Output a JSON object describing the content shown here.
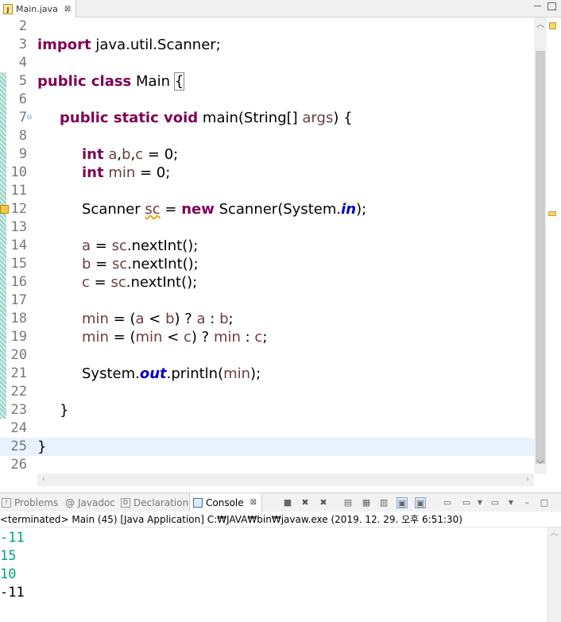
{
  "editor_tab": {
    "title": "Main.java",
    "close": "⊠",
    "icon": "J"
  },
  "window_buttons": {
    "minimize": "",
    "maximize": ""
  },
  "code_lines": [
    {
      "num": "2"
    },
    {
      "num": "3"
    },
    {
      "num": "4"
    },
    {
      "num": "5"
    },
    {
      "num": "6"
    },
    {
      "num": "7"
    },
    {
      "num": "8"
    },
    {
      "num": "9"
    },
    {
      "num": "10"
    },
    {
      "num": "11"
    },
    {
      "num": "12"
    },
    {
      "num": "13"
    },
    {
      "num": "14"
    },
    {
      "num": "15"
    },
    {
      "num": "16"
    },
    {
      "num": "17"
    },
    {
      "num": "18"
    },
    {
      "num": "19"
    },
    {
      "num": "20"
    },
    {
      "num": "21"
    },
    {
      "num": "22"
    },
    {
      "num": "23"
    },
    {
      "num": "24"
    },
    {
      "num": "25"
    },
    {
      "num": "26"
    }
  ],
  "code": {
    "l3_kw": "import",
    "l3_rest": " java.util.Scanner;",
    "l5_kw": "public class",
    "l5_name": " Main ",
    "l5_brace": "{",
    "l7_kw": "public static void",
    "l7_sig": " main(String[] ",
    "l7_args": "args",
    "l7_end": ") {",
    "l9_kw": "int",
    "l9_a": "a",
    "l9_c1": ",",
    "l9_b": "b",
    "l9_c2": ",",
    "l9_c": "c",
    "l9_rest": " = 0;",
    "l10_kw": "int",
    "l10_min": "min",
    "l10_rest": " = 0;",
    "l12_t": "Scanner ",
    "l12_sc": "sc",
    "l12_eq": " = ",
    "l12_new": "new",
    "l12_call": " Scanner(System.",
    "l12_in": "in",
    "l12_end": ");",
    "l14_v": "a",
    "l14_eq": " = ",
    "l14_sc": "sc",
    "l14_call": ".nextInt();",
    "l15_v": "b",
    "l15_eq": " = ",
    "l15_sc": "sc",
    "l15_call": ".nextInt();",
    "l16_v": "c",
    "l16_eq": " = ",
    "l16_sc": "sc",
    "l16_call": ".nextInt();",
    "l18_min": "min",
    "l18_p1": " = (",
    "l18_a": "a",
    "l18_lt": " < ",
    "l18_b": "b",
    "l18_q": ") ? ",
    "l18_a2": "a",
    "l18_col": " : ",
    "l18_b2": "b",
    "l18_end": ";",
    "l19_min": "min",
    "l19_p1": " = (",
    "l19_min2": "min",
    "l19_lt": " < ",
    "l19_c": "c",
    "l19_q": ") ? ",
    "l19_min3": "min",
    "l19_col": " : ",
    "l19_c2": "c",
    "l19_end": ";",
    "l21_sys": "System.",
    "l21_out": "out",
    "l21_call": ".println(",
    "l21_min": "min",
    "l21_end": ");",
    "l23": "}",
    "l25": "}"
  },
  "console": {
    "tabs": {
      "problems": "Problems",
      "javadoc": "Javadoc",
      "declaration": "Declaration",
      "console": "Console"
    },
    "status": "<terminated> Main (45) [Java Application] C:₩JAVA₩bin₩javaw.exe (2019. 12. 29. 오후 6:51:30)",
    "output": [
      "-11",
      "15",
      "10",
      "-11"
    ]
  },
  "colors": {
    "keyword": "#7f0055",
    "static_field": "#0000c0",
    "local_var": "#6a3e3e",
    "stdin": "#00a380"
  }
}
